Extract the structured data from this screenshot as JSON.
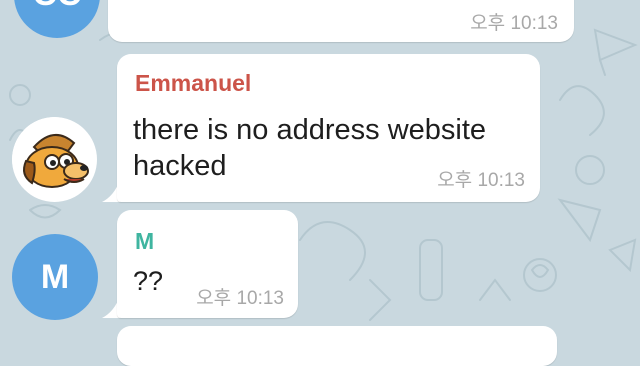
{
  "chat": {
    "messages": [
      {
        "avatar_initials": "CC",
        "avatar_color": "#5aa2e0",
        "time": "오후 10:13"
      },
      {
        "sender": "Emmanuel",
        "sender_color": "#cc5449",
        "text_line1": "there is no address website",
        "text_line2": "hacked",
        "time": "오후 10:13",
        "avatar_icon": "cartoon-dog-avatar"
      },
      {
        "sender": "M",
        "sender_color": "#3fb5a0",
        "avatar_initials": "M",
        "avatar_color": "#5aa2e0",
        "text_line1": "??",
        "time": "오후 10:13"
      }
    ]
  }
}
